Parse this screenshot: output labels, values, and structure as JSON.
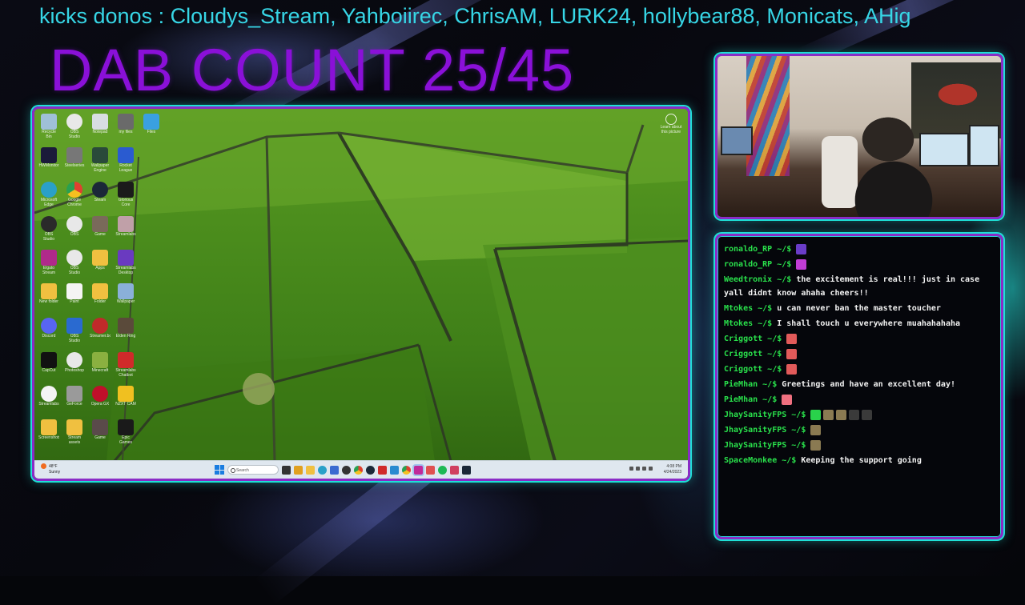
{
  "overlay": {
    "ticker_text": "kicks donos : Cloudys_Stream, Yahboiirec, ChrisAM, LURK24, hollybear88, Monicats, AHig",
    "dab_count": "DAB COUNT 25/45",
    "colors": {
      "ticker": "#37d6e6",
      "dab": "#8a10d8",
      "frame_outer": "#1fe0d6",
      "frame_inner": "#8a2cc6",
      "chat_user": "#29e04b"
    }
  },
  "desktop": {
    "icons": [
      [
        "Recycle Bin",
        "OBS Studio",
        "Notepad",
        "my files",
        "Files"
      ],
      [
        "HWMonitor",
        "Steelseries",
        "Wallpaper Engine",
        "Rocket League"
      ],
      [
        "Microsoft Edge",
        "Google Chrome",
        "Steam",
        "Glorious Core"
      ],
      [
        "OBS Studio",
        "OBS",
        "Game",
        "Streamlabs"
      ],
      [
        "Elgato Stream Deck",
        "OBS Studio",
        "Apps",
        "Streamlabs Desktop"
      ],
      [
        "New folder",
        "Paint",
        "Folder",
        "Wallpaper"
      ],
      [
        "Discord",
        "OBS Studio",
        "Streamer.bot",
        "Elden Ring"
      ],
      [
        "CapCut",
        "Photoshop",
        "Minecraft",
        "Streamlabs Chatbot"
      ],
      [
        "Streamlabs",
        "GeForce",
        "Opera GX",
        "NZXT CAM"
      ],
      [
        "Screenshots",
        "Stream assets",
        "Game",
        "Epic Games Launcher"
      ]
    ],
    "learn_label": "Learn about this picture",
    "taskbar": {
      "weather_temp": "48°F",
      "weather_desc": "Sunny",
      "search_placeholder": "Search",
      "time": "4:08 PM",
      "date": "4/24/2023"
    }
  },
  "chat": {
    "messages": [
      {
        "user": "ronaldo_RP ~/$",
        "text": "",
        "emotes": [
          "#6a3cc8"
        ]
      },
      {
        "user": "ronaldo_RP ~/$",
        "text": "",
        "emotes": [
          "#c23dd6"
        ]
      },
      {
        "user": "Weedtronix ~/$",
        "text": "the excitement is real!!! just in case yall didnt know ahaha cheers!!",
        "emotes": []
      },
      {
        "user": "Mtokes ~/$",
        "text": "u can never ban the master toucher",
        "emotes": []
      },
      {
        "user": "Mtokes ~/$",
        "text": "I shall touch u everywhere muahahahaha",
        "emotes": []
      },
      {
        "user": "Criggott ~/$",
        "text": "",
        "emotes": [
          "#e25a5a"
        ]
      },
      {
        "user": "Criggott ~/$",
        "text": "",
        "emotes": [
          "#e25a5a"
        ]
      },
      {
        "user": "Criggott ~/$",
        "text": "",
        "emotes": [
          "#e25a5a"
        ]
      },
      {
        "user": "PieMhan ~/$",
        "text": "Greetings and have an excellent day!",
        "emotes": []
      },
      {
        "user": "PieMhan ~/$",
        "text": "",
        "emotes": [
          "#f07080"
        ]
      },
      {
        "user": "JhaySanityFPS ~/$",
        "text": "",
        "emotes": [
          "#29d24b",
          "#8a7a52",
          "#8a7a52",
          "#3a3a3a",
          "#3a3a3a"
        ]
      },
      {
        "user": "JhaySanityFPS ~/$",
        "text": "",
        "emotes": [
          "#8a7a52"
        ]
      },
      {
        "user": "JhaySanityFPS ~/$",
        "text": "",
        "emotes": [
          "#8a7a52"
        ]
      },
      {
        "user": "SpaceMonkee ~/$",
        "text": "Keeping the support going",
        "emotes": []
      }
    ]
  }
}
